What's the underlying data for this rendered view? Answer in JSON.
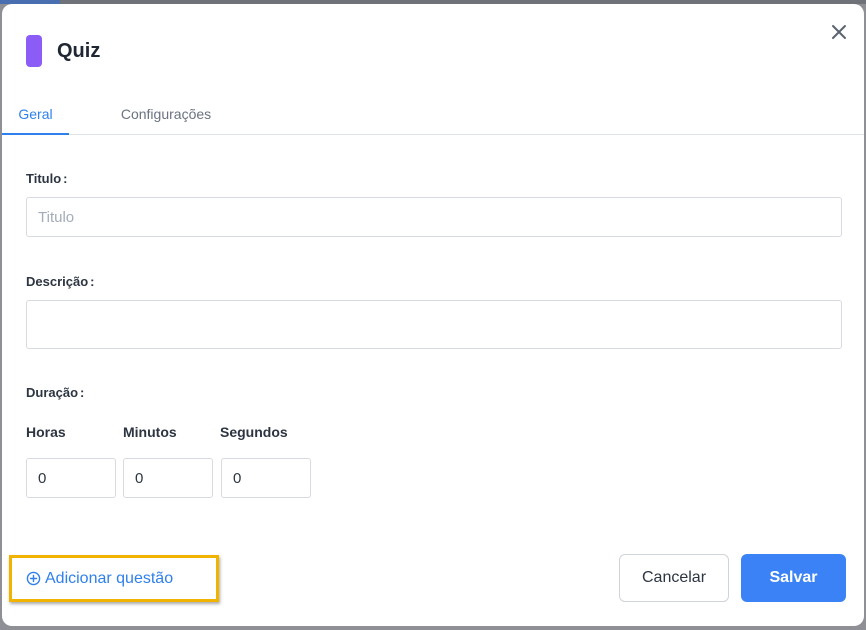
{
  "colors": {
    "badge": "#8b5cf6",
    "accent": "#2f80ed",
    "save": "#3b82f6",
    "highlight": "#f0b400"
  },
  "modal": {
    "title": "Quiz",
    "close_icon": "close-icon"
  },
  "tabs": [
    {
      "label": "Geral",
      "active": true
    },
    {
      "label": "Configurações",
      "active": false
    }
  ],
  "form": {
    "titulo": {
      "label": "Titulo",
      "separator": ":",
      "placeholder": "Titulo",
      "value": ""
    },
    "descricao": {
      "label": "Descrição",
      "separator": ":",
      "value": ""
    },
    "duracao": {
      "label": "Duração",
      "separator": ":",
      "horas": {
        "label": "Horas",
        "value": "0"
      },
      "minutos": {
        "label": "Minutos",
        "value": "0"
      },
      "segundos": {
        "label": "Segundos",
        "value": "0"
      }
    }
  },
  "footer": {
    "add_question": {
      "icon": "plus-circle-icon",
      "label": "Adicionar questão"
    },
    "cancel_label": "Cancelar",
    "save_label": "Salvar"
  }
}
